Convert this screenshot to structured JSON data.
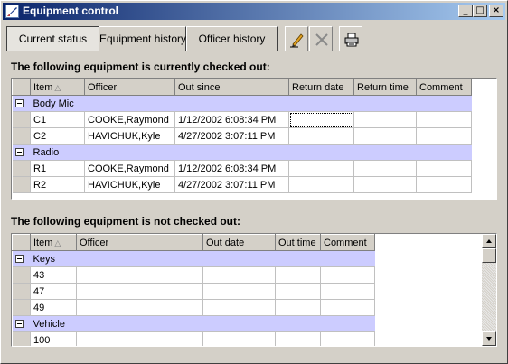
{
  "window": {
    "title": "Equipment control",
    "controls": {
      "minimize": "_",
      "maximize": "□",
      "close": "×"
    }
  },
  "tabs": [
    {
      "label": "Current status",
      "active": true
    },
    {
      "label": "Equipment history",
      "active": false
    },
    {
      "label": "Officer history",
      "active": false
    }
  ],
  "toolbar": {
    "edit_icon": "pencil-icon",
    "delete_icon": "x-icon",
    "print_icon": "printer-icon"
  },
  "checked_out": {
    "heading": "The following equipment is currently checked out:",
    "columns": [
      "Item",
      "Officer",
      "Out since",
      "Return date",
      "Return time",
      "Comment"
    ],
    "groups": [
      {
        "name": "Body Mic",
        "rows": [
          {
            "item": "C1",
            "officer": "COOKE,Raymond",
            "out_since": "1/12/2002 6:08:34 PM",
            "return_date": "",
            "return_time": "",
            "comment": ""
          },
          {
            "item": "C2",
            "officer": "HAVICHUK,Kyle",
            "out_since": "4/27/2002 3:07:11 PM",
            "return_date": "",
            "return_time": "",
            "comment": ""
          }
        ]
      },
      {
        "name": "Radio",
        "rows": [
          {
            "item": "R1",
            "officer": "COOKE,Raymond",
            "out_since": "1/12/2002 6:08:34 PM",
            "return_date": "",
            "return_time": "",
            "comment": ""
          },
          {
            "item": "R2",
            "officer": "HAVICHUK,Kyle",
            "out_since": "4/27/2002 3:07:11 PM",
            "return_date": "",
            "return_time": "",
            "comment": ""
          }
        ]
      }
    ]
  },
  "not_checked_out": {
    "heading": "The following equipment is not checked out:",
    "columns": [
      "Item",
      "Officer",
      "Out date",
      "Out time",
      "Comment"
    ],
    "groups": [
      {
        "name": "Keys",
        "rows": [
          {
            "item": "43"
          },
          {
            "item": "47"
          },
          {
            "item": "49"
          }
        ]
      },
      {
        "name": "Vehicle",
        "rows": [
          {
            "item": "100"
          }
        ]
      }
    ]
  },
  "colors": {
    "group_row": "#ccccff",
    "titlebar_start": "#0a246a",
    "titlebar_end": "#a6caf0",
    "face": "#d4d0c8"
  }
}
